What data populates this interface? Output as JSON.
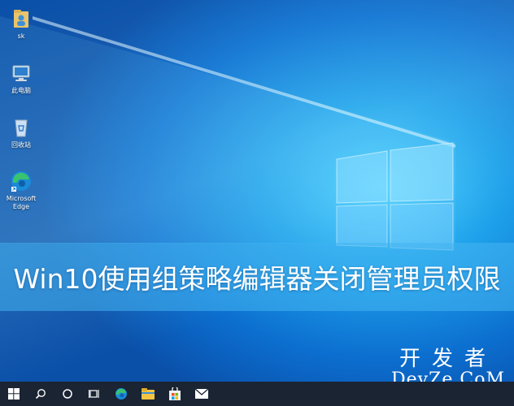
{
  "desktop": {
    "icons": [
      {
        "label": "sk",
        "icon": "user-folder-icon"
      },
      {
        "label": "此电脑",
        "icon": "this-pc-icon"
      },
      {
        "label": "回收站",
        "icon": "recycle-bin-icon"
      },
      {
        "label": "Microsoft\nEdge",
        "icon": "edge-icon"
      }
    ]
  },
  "banner": {
    "title": "Win10使用组策略编辑器关闭管理员权限"
  },
  "watermark": {
    "cn": "开发者",
    "en": "DevZe.CoM"
  },
  "taskbar": {
    "items": [
      "start-icon",
      "search-icon",
      "cortana-icon",
      "task-view-icon",
      "edge-icon",
      "file-explorer-icon",
      "store-icon",
      "mail-icon"
    ]
  },
  "colors": {
    "taskbar": "#1a2433",
    "banner": "#46b4f0",
    "desktop_bg": "#0c6fd0"
  }
}
